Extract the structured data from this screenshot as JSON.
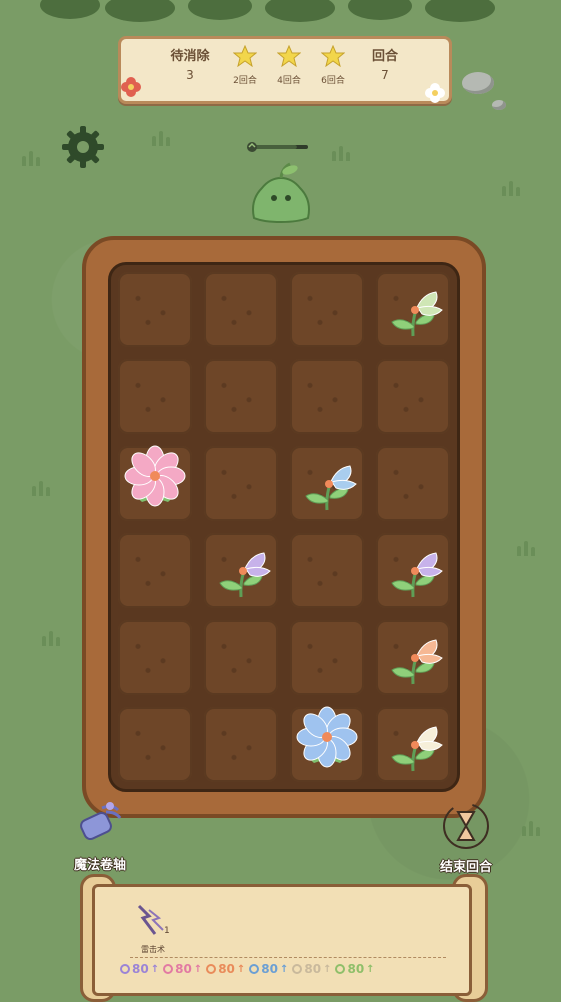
{
  "banner": {
    "pending_label": "待消除",
    "pending_value": "3",
    "stars": [
      {
        "label": "2回合"
      },
      {
        "label": "4回合"
      },
      {
        "label": "6回合"
      }
    ],
    "round_label": "回合",
    "round_value": "7"
  },
  "enemy": {
    "hp_fraction": 0.8
  },
  "garden": {
    "rows": 6,
    "cols": 4,
    "plants": [
      {
        "row": 0,
        "col": 3,
        "type": "sprout",
        "color": "#cfe6b5"
      },
      {
        "row": 2,
        "col": 0,
        "type": "bloom",
        "color": "#f4a9c5"
      },
      {
        "row": 2,
        "col": 2,
        "type": "sprout",
        "color": "#a9cdee"
      },
      {
        "row": 3,
        "col": 1,
        "type": "sprout",
        "color": "#c7b2ea"
      },
      {
        "row": 3,
        "col": 3,
        "type": "sprout",
        "color": "#c7b2ea"
      },
      {
        "row": 4,
        "col": 3,
        "type": "sprout",
        "color": "#f6b894"
      },
      {
        "row": 5,
        "col": 2,
        "type": "bloom",
        "color": "#9fc3ef"
      },
      {
        "row": 5,
        "col": 3,
        "type": "sprout",
        "color": "#f6efd9"
      }
    ]
  },
  "actions": {
    "magic_scroll": "魔法卷轴",
    "end_turn": "结束回合"
  },
  "skill": {
    "name": "雷击术",
    "count": "1"
  },
  "resources": [
    {
      "value": "80",
      "color": "#9b84d6"
    },
    {
      "value": "80",
      "color": "#e27aa3"
    },
    {
      "value": "80",
      "color": "#e98b5a"
    },
    {
      "value": "80",
      "color": "#6b9fd4"
    },
    {
      "value": "80",
      "color": "#c9b99c"
    },
    {
      "value": "80",
      "color": "#8fbf6a"
    }
  ]
}
